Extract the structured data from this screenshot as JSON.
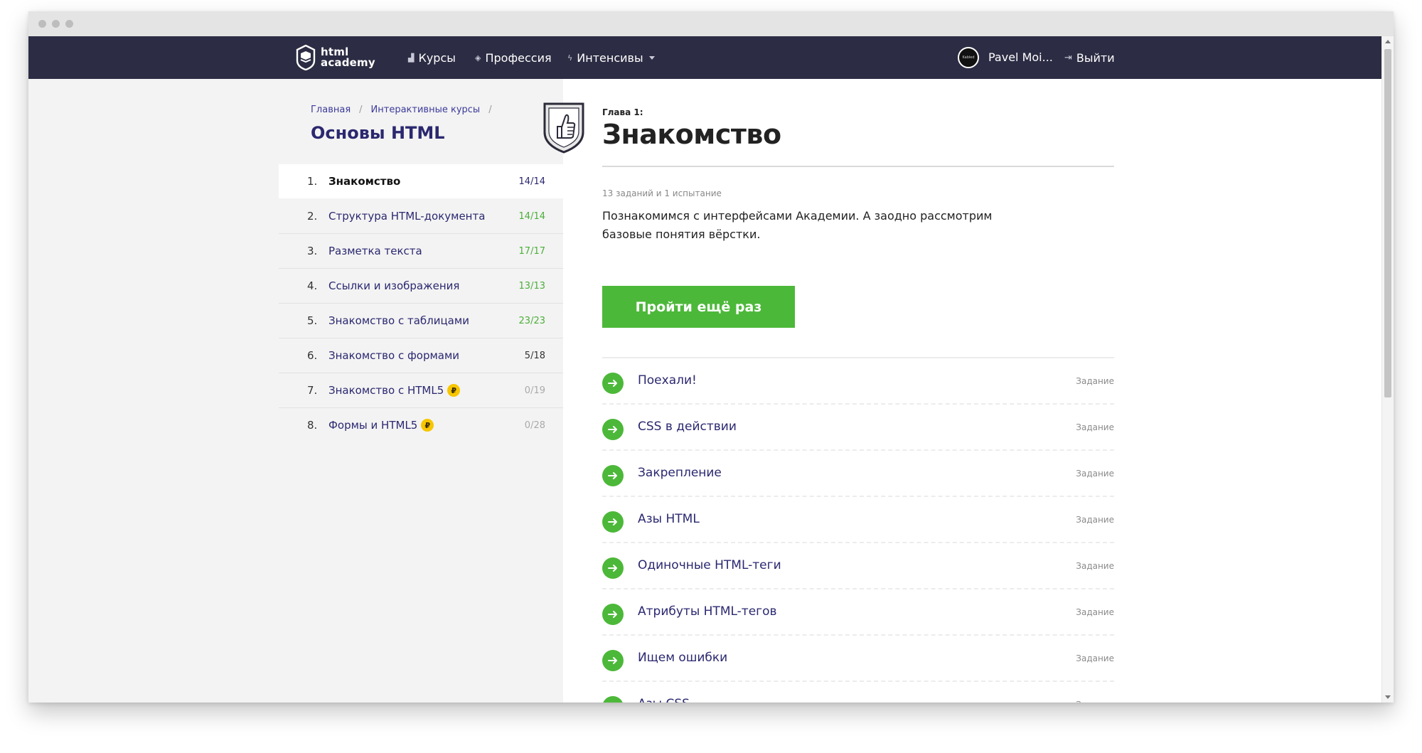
{
  "header": {
    "logo": {
      "line1": "html",
      "line2": "academy"
    },
    "nav": [
      {
        "label": "Курсы",
        "icon": "bar-chart-icon"
      },
      {
        "label": "Профессия",
        "icon": "graduation-cap-icon"
      },
      {
        "label": "Интенсивы",
        "icon": "lightning-icon"
      }
    ],
    "user": {
      "name": "Pavel Moi...",
      "avatar_text": "Kabled"
    },
    "logout_label": "Выйти"
  },
  "sidebar": {
    "breadcrumb": [
      "Главная",
      "Интерактивные курсы"
    ],
    "breadcrumb_sep": "/",
    "course_title": "Основы HTML",
    "chapters": [
      {
        "num": "1.",
        "title": "Знакомство",
        "count": "14/14",
        "active": true
      },
      {
        "num": "2.",
        "title": "Структура HTML-документа",
        "count": "14/14"
      },
      {
        "num": "3.",
        "title": "Разметка текста",
        "count": "17/17"
      },
      {
        "num": "4.",
        "title": "Ссылки и изображения",
        "count": "13/13"
      },
      {
        "num": "5.",
        "title": "Знакомство с таблицами",
        "count": "23/23"
      },
      {
        "num": "6.",
        "title": "Знакомство с формами",
        "count": "5/18"
      },
      {
        "num": "7.",
        "title": "Знакомство с HTML5",
        "count": "0/19",
        "paid": true
      },
      {
        "num": "8.",
        "title": "Формы и HTML5",
        "count": "0/28",
        "paid": true
      }
    ],
    "coin_symbol": "₽"
  },
  "main": {
    "chapter_label": "Глава 1:",
    "chapter_title": "Знакомство",
    "meta": "13 заданий и 1 испытание",
    "description": "Познакомимся с интерфейсами Академии. А заодно рассмотрим базовые понятия вёрстки.",
    "retry_label": "Пройти ещё раз",
    "tasks": [
      {
        "title": "Поехали!",
        "type": "Задание"
      },
      {
        "title": "CSS в действии",
        "type": "Задание"
      },
      {
        "title": "Закрепление",
        "type": "Задание"
      },
      {
        "title": "Азы HTML",
        "type": "Задание"
      },
      {
        "title": "Одиночные HTML-теги",
        "type": "Задание"
      },
      {
        "title": "Атрибуты HTML-тегов",
        "type": "Задание"
      },
      {
        "title": "Ищем ошибки",
        "type": "Задание"
      },
      {
        "title": "Азы CSS",
        "type": "Задание"
      }
    ]
  },
  "colors": {
    "header_bg": "#2c2c44",
    "accent_green": "#4cb839",
    "link_blue": "#2b2870",
    "coin_yellow": "#f7c600"
  }
}
